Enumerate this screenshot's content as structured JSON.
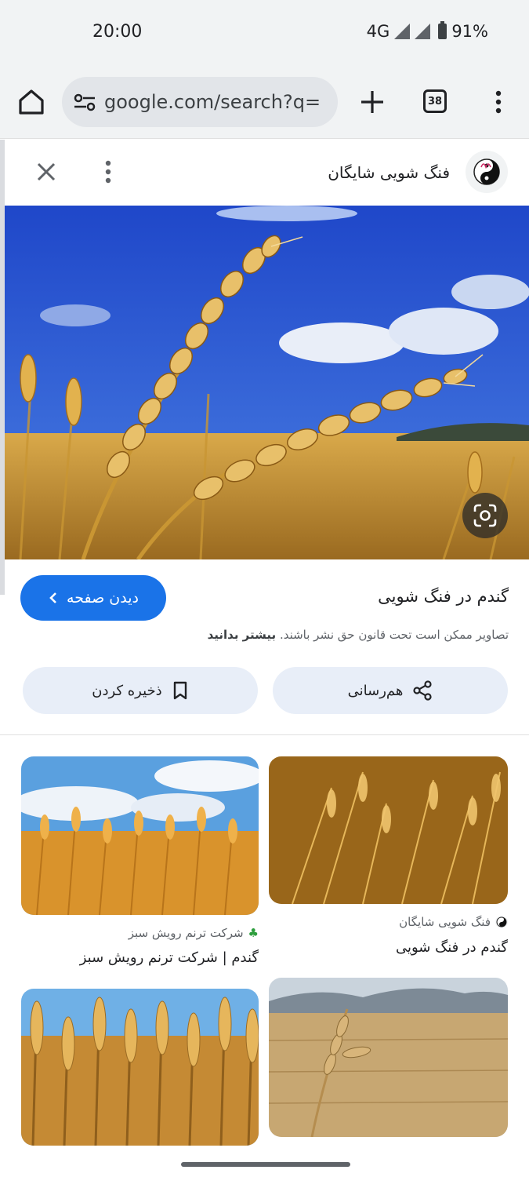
{
  "status_bar": {
    "time": "20:00",
    "network": "4G",
    "battery": "91%"
  },
  "toolbar": {
    "url": "google.com/search?q=",
    "tab_count": "38"
  },
  "panel": {
    "source_name": "فنگ شویی شایگان",
    "image_title": "گندم در فنگ شویی",
    "visit_label": "دیدن صفحه",
    "copyright_text": "تصاویر ممکن است تحت قانون حق نشر باشند.",
    "learn_more": "بیشتر بدانید",
    "save_label": "ذخیره کردن",
    "share_label": "هم‌رسانی"
  },
  "results": [
    {
      "source": "فنگ شویی شایگان",
      "title": "گندم در فنگ شویی"
    },
    {
      "source": "شرکت ترنم رویش سبز",
      "title": "گندم | شرکت ترنم رویش سبز"
    }
  ],
  "colors": {
    "accent": "#1a73e8",
    "pill_bg": "#e8eef8",
    "toolbar_bg": "#f1f3f4"
  },
  "icons": [
    "home-icon",
    "tune-icon",
    "plus-icon",
    "tabs-icon",
    "more-vert-icon",
    "close-icon",
    "lens-icon",
    "chevron-left-icon",
    "bookmark-icon",
    "share-icon"
  ]
}
